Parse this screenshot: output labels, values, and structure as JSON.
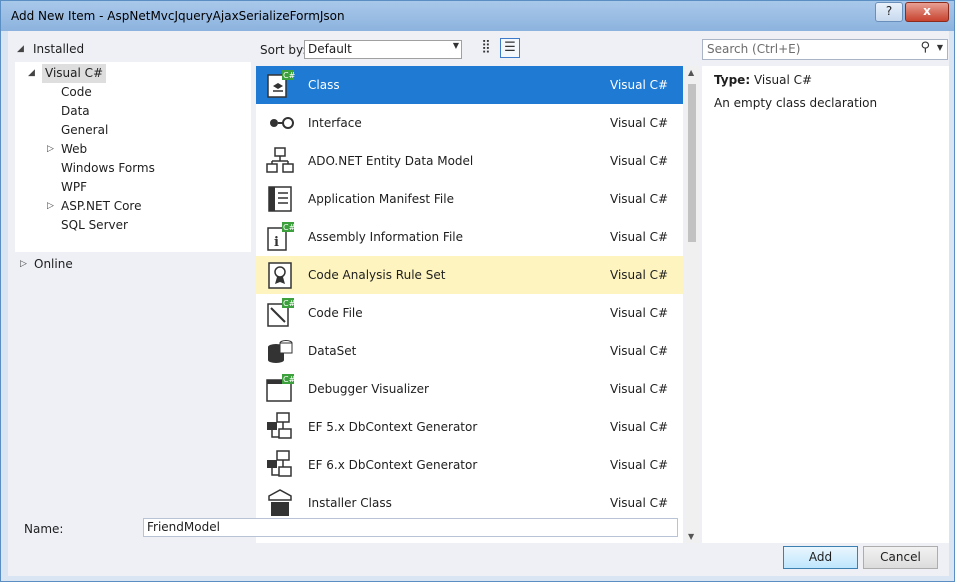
{
  "window": {
    "title": "Add New Item - AspNetMvcJqueryAjaxSerializeFormJson",
    "help_label": "?",
    "close_label": "x"
  },
  "tree": {
    "installed_label": "Installed",
    "root_label": "Visual C#",
    "children": [
      "Code",
      "Data",
      "General",
      "Web",
      "Windows Forms",
      "WPF",
      "ASP.NET Core",
      "SQL Server"
    ],
    "online_label": "Online"
  },
  "toolbar": {
    "sort_label": "Sort by:",
    "sort_value": "Default"
  },
  "search": {
    "placeholder": "Search (Ctrl+E)"
  },
  "items": [
    {
      "name": "Class",
      "lang": "Visual C#",
      "icon": "class-icon"
    },
    {
      "name": "Interface",
      "lang": "Visual C#",
      "icon": "interface-icon"
    },
    {
      "name": "ADO.NET Entity Data Model",
      "lang": "Visual C#",
      "icon": "entity-model-icon"
    },
    {
      "name": "Application Manifest File",
      "lang": "Visual C#",
      "icon": "manifest-icon"
    },
    {
      "name": "Assembly Information File",
      "lang": "Visual C#",
      "icon": "assembly-info-icon"
    },
    {
      "name": "Code Analysis Rule Set",
      "lang": "Visual C#",
      "icon": "rule-set-icon"
    },
    {
      "name": "Code File",
      "lang": "Visual C#",
      "icon": "code-file-icon"
    },
    {
      "name": "DataSet",
      "lang": "Visual C#",
      "icon": "dataset-icon"
    },
    {
      "name": "Debugger Visualizer",
      "lang": "Visual C#",
      "icon": "debugger-visualizer-icon"
    },
    {
      "name": "EF 5.x DbContext Generator",
      "lang": "Visual C#",
      "icon": "ef-generator-icon"
    },
    {
      "name": "EF 6.x DbContext Generator",
      "lang": "Visual C#",
      "icon": "ef-generator-icon"
    },
    {
      "name": "Installer Class",
      "lang": "Visual C#",
      "icon": "installer-icon"
    }
  ],
  "details": {
    "type_label": "Type:",
    "type_value": "Visual C#",
    "description": "An empty class declaration"
  },
  "name_field": {
    "label": "Name:",
    "value": "FriendModel"
  },
  "buttons": {
    "add": "Add",
    "cancel": "Cancel"
  },
  "colors": {
    "selection": "#1f7ad3",
    "hover": "#fdf4bf",
    "csharp_badge": "#3ca13c"
  }
}
